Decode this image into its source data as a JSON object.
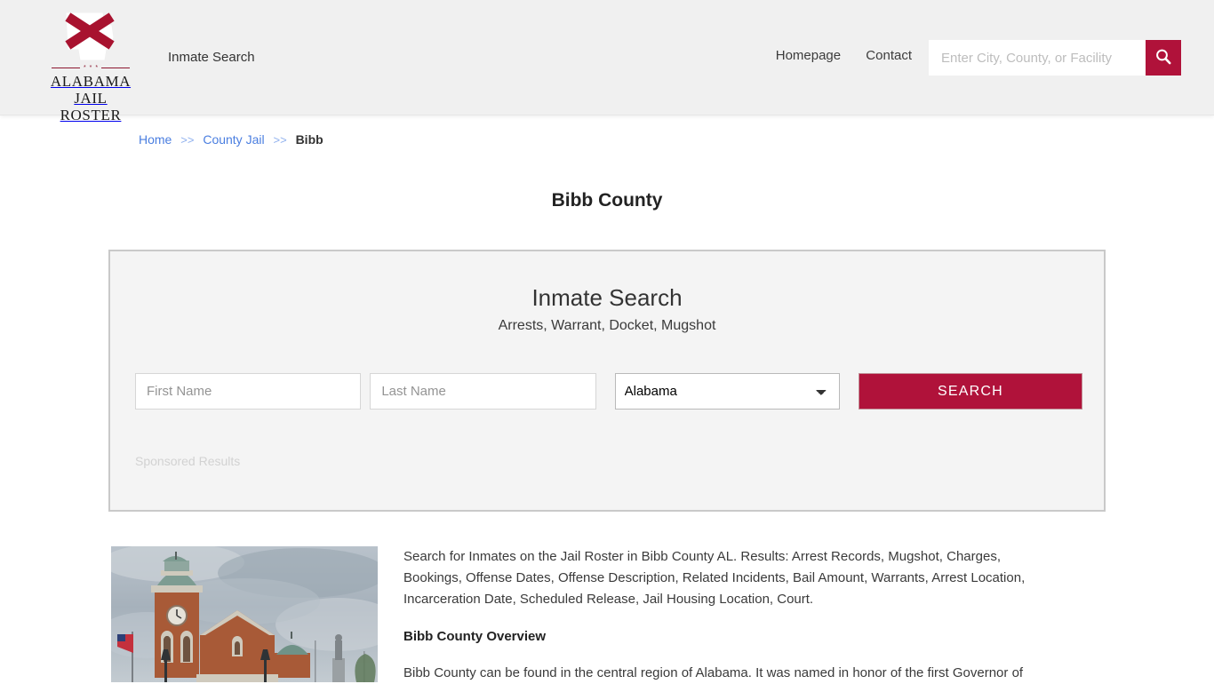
{
  "header": {
    "logo": {
      "line1": "ALABAMA",
      "line2": "JAIL ROSTER",
      "mark_name": "alabama-state-outline-with-red-cross",
      "stars": "* * *"
    },
    "tagline": "Inmate Search",
    "nav": [
      {
        "label": "Homepage"
      },
      {
        "label": "Contact"
      }
    ],
    "search": {
      "placeholder": "Enter City, County, or Facility",
      "value": "",
      "button_icon": "search-icon"
    }
  },
  "breadcrumb": {
    "items": [
      {
        "label": "Home",
        "link": true
      },
      {
        "label": "County Jail",
        "link": true
      },
      {
        "label": "Bibb",
        "link": false
      }
    ],
    "separator": ">>"
  },
  "page_title": "Bibb County",
  "search_panel": {
    "title": "Inmate Search",
    "subtitle": "Arrests, Warrant, Docket, Mugshot",
    "first_name": {
      "placeholder": "First Name",
      "value": ""
    },
    "last_name": {
      "placeholder": "Last Name",
      "value": ""
    },
    "state_select": {
      "selected": "Alabama"
    },
    "submit_label": "SEARCH",
    "sponsored_label": "Sponsored Results"
  },
  "content": {
    "photo_alt": "bibb-county-courthouse-photo",
    "intro": "Search for Inmates on the Jail Roster in Bibb County AL. Results: Arrest Records, Mugshot, Charges, Bookings, Offense Dates, Offense Description, Related Incidents, Bail Amount, Warrants, Arrest Location, Incarceration Date, Scheduled Release, Jail Housing Location, Court.",
    "overview_heading": "Bibb County Overview",
    "overview_body": "Bibb County can be found in the central region of Alabama. It was named in honor of the first Governor of"
  },
  "colors": {
    "crimson": "#b0123a",
    "header_bg": "#f0f0f0",
    "panel_bg": "#f4f4f4",
    "panel_border": "#c9c9c9",
    "link_blue": "#4a7ee0"
  }
}
